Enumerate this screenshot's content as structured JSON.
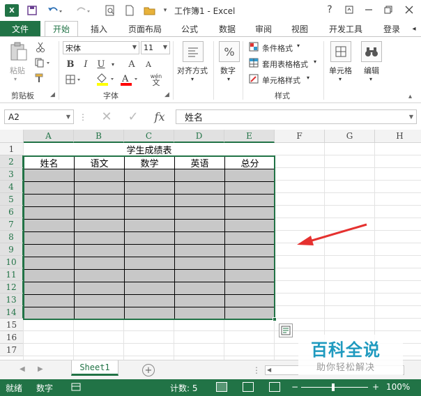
{
  "window": {
    "title": "工作簿1 - Excel",
    "app_icon": "X",
    "help": "?"
  },
  "ribbon_tabs": {
    "file": "文件",
    "items": [
      "开始",
      "插入",
      "页面布局",
      "公式",
      "数据",
      "审阅",
      "视图",
      "开发工具"
    ],
    "active": "开始",
    "login": "登录"
  },
  "ribbon": {
    "paste_label": "粘贴",
    "clipboard_group": "剪贴板",
    "font_name": "宋体",
    "font_size": "11",
    "bold": "B",
    "italic": "I",
    "underline": "U",
    "grow_font": "A",
    "shrink_font": "A",
    "phonetic": "wén",
    "font_group": "字体",
    "alignment": "对齐方式",
    "number": "数字",
    "number_icon": "%",
    "conditional_format": "条件格式",
    "format_as_table": "套用表格格式",
    "cell_styles": "单元格样式",
    "styles_group": "样式",
    "cells": "单元格",
    "editing": "编辑",
    "colors": {
      "fill_color": "#ffff00",
      "font_color": "#ff0000"
    }
  },
  "formula_bar": {
    "name_box": "A2",
    "cancel_icon": "✕",
    "enter_icon": "✓",
    "fx": "fx",
    "content": "姓名"
  },
  "sheet": {
    "columns": [
      "A",
      "B",
      "C",
      "D",
      "E",
      "F",
      "G",
      "H"
    ],
    "rows": [
      "1",
      "2",
      "3",
      "4",
      "5",
      "6",
      "7",
      "8",
      "9",
      "10",
      "11",
      "12",
      "13",
      "14",
      "15",
      "16",
      "17"
    ],
    "title_cell": "学生成绩表",
    "headers": [
      "姓名",
      "语文",
      "数学",
      "英语",
      "总分"
    ],
    "selected_range_fill": "#c8c8c8",
    "accent": "#217346"
  },
  "sheet_tabs": {
    "active": "Sheet1",
    "add": "+"
  },
  "statusbar": {
    "ready": "就绪",
    "mode": "数字",
    "count": "计数: 5",
    "zoom_minus": "−",
    "zoom_plus": "+",
    "zoom": "100%"
  },
  "watermark": {
    "title": "百科全说",
    "subtitle": "助你轻松解决"
  }
}
